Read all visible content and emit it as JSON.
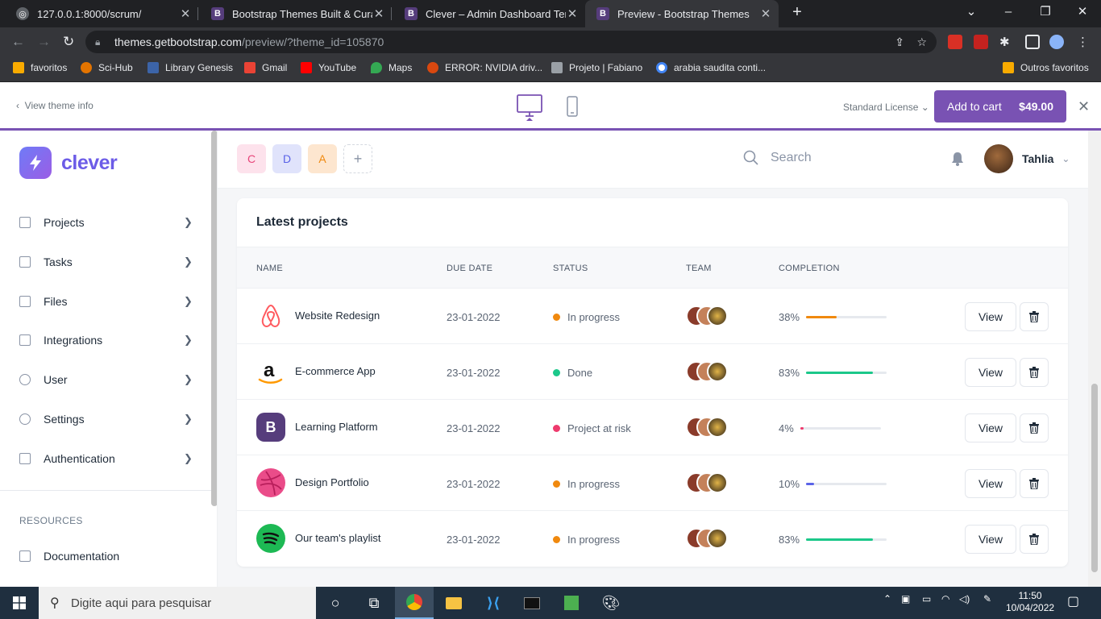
{
  "browser": {
    "tabs": [
      {
        "title": "127.0.0.1:8000/scrum/",
        "favicon": "globe-icon"
      },
      {
        "title": "Bootstrap Themes Built & Curate",
        "favicon": "bootstrap-icon"
      },
      {
        "title": "Clever – Admin Dashboard Temp",
        "favicon": "bootstrap-icon"
      },
      {
        "title": "Preview - Bootstrap Themes",
        "favicon": "bootstrap-icon"
      }
    ],
    "url_host": "themes.getbootstrap.com",
    "url_path": "/preview/?theme_id=105870",
    "bookmarks": [
      "favoritos",
      "Sci-Hub",
      "Library Genesis",
      "Gmail",
      "YouTube",
      "Maps",
      "ERROR: NVIDIA driv...",
      "Projeto | Fabiano",
      "arabia saudita conti..."
    ],
    "other_bookmarks": "Outros favoritos"
  },
  "preview": {
    "back_label": "View theme info",
    "license_label": "Standard License",
    "cart_label": "Add to cart",
    "cart_price": "$49.00"
  },
  "sidebar": {
    "brand": "clever",
    "items": [
      {
        "label": "Projects",
        "icon": "briefcase-icon"
      },
      {
        "label": "Tasks",
        "icon": "kanban-icon"
      },
      {
        "label": "Files",
        "icon": "file-icon"
      },
      {
        "label": "Integrations",
        "icon": "terminal-icon"
      },
      {
        "label": "User",
        "icon": "users-icon"
      },
      {
        "label": "Settings",
        "icon": "gear-icon"
      },
      {
        "label": "Authentication",
        "icon": "user-lock-icon"
      }
    ],
    "resources_heading": "RESOURCES",
    "resources": [
      {
        "label": "Documentation",
        "icon": "code-icon"
      }
    ]
  },
  "topbar": {
    "workspaces": [
      "C",
      "D",
      "A"
    ],
    "add_label": "+",
    "search_placeholder": "Search",
    "user_name": "Tahlia"
  },
  "projects": {
    "title": "Latest projects",
    "columns": [
      "NAME",
      "DUE DATE",
      "STATUS",
      "TEAM",
      "COMPLETION"
    ],
    "view_label": "View",
    "rows": [
      {
        "name": "Website Redesign",
        "due": "23-01-2022",
        "status": "In progress",
        "status_color": "#f0890e",
        "completion": "38%",
        "pct": 0.38,
        "bar_color": "#f0890e",
        "logo": "airbnb-icon"
      },
      {
        "name": "E-commerce App",
        "due": "23-01-2022",
        "status": "Done",
        "status_color": "#1cc88a",
        "completion": "83%",
        "pct": 0.83,
        "bar_color": "#1cc88a",
        "logo": "amazon-icon"
      },
      {
        "name": "Learning Platform",
        "due": "23-01-2022",
        "status": "Project at risk",
        "status_color": "#ee3a6d",
        "completion": "4%",
        "pct": 0.04,
        "bar_color": "#ee3a6d",
        "logo": "bootstrap-icon"
      },
      {
        "name": "Design Portfolio",
        "due": "23-01-2022",
        "status": "In progress",
        "status_color": "#f0890e",
        "completion": "10%",
        "pct": 0.1,
        "bar_color": "#5a63e8",
        "logo": "dribbble-icon"
      },
      {
        "name": "Our team's playlist",
        "due": "23-01-2022",
        "status": "In progress",
        "status_color": "#f0890e",
        "completion": "83%",
        "pct": 0.83,
        "bar_color": "#1cc88a",
        "logo": "spotify-icon"
      }
    ]
  },
  "taskbar": {
    "search_placeholder": "Digite aqui para pesquisar",
    "time": "11:50",
    "date": "10/04/2022"
  }
}
